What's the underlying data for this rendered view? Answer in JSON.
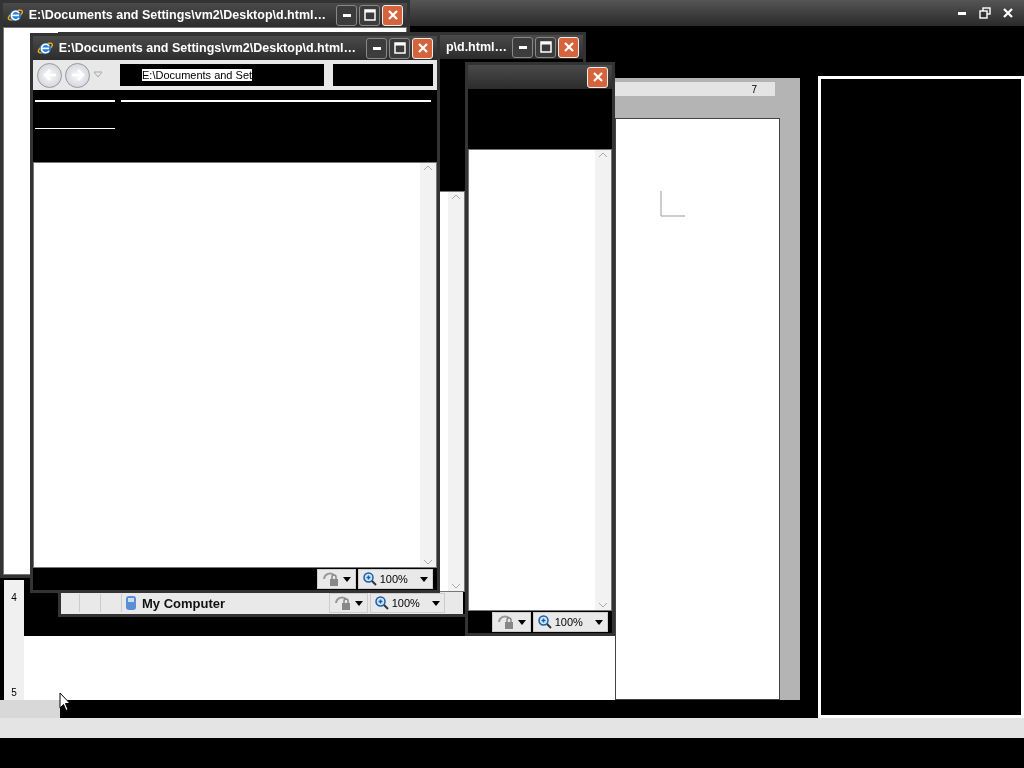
{
  "windows": [
    {
      "title": "E:\\Documents and Settings\\vm2\\Desktop\\d.html…"
    },
    {
      "title": "p\\d.html…",
      "status_text": "My Computer",
      "zoom": "100%"
    },
    {
      "zoom": "100%"
    },
    {
      "title": "E:\\Documents and Settings\\vm2\\Desktop\\d.html…",
      "address": "E:\\Documents and Set",
      "zoom": "100%"
    }
  ],
  "document": {
    "ruler_marks": [
      "7"
    ],
    "vertical_ruler_marks": [
      "4",
      "5"
    ]
  }
}
